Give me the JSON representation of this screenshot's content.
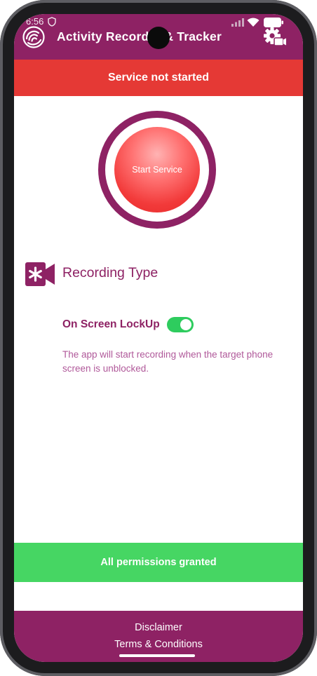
{
  "status_bar": {
    "time": "6:56"
  },
  "app_bar": {
    "title": "Activity Recorder & Tracker"
  },
  "service": {
    "status_text": "Service not started",
    "button_label": "Start Service"
  },
  "recording": {
    "section_title": "Recording Type",
    "option_label": "On Screen LockUp",
    "option_enabled": true,
    "description": "The app will start recording when the target phone screen is unblocked."
  },
  "permissions": {
    "status_text": "All permissions granted"
  },
  "footer": {
    "disclaimer": "Disclaimer",
    "terms": "Terms & Conditions"
  },
  "colors": {
    "primary": "#8e2264",
    "error": "#e53935",
    "success": "#46d663",
    "toggle_on": "#2ecc5e"
  },
  "icons": [
    "app-logo-icon",
    "shield-icon",
    "signal-icon",
    "wifi-icon",
    "battery-icon",
    "settings-camera-icon",
    "camera-asterisk-icon"
  ]
}
